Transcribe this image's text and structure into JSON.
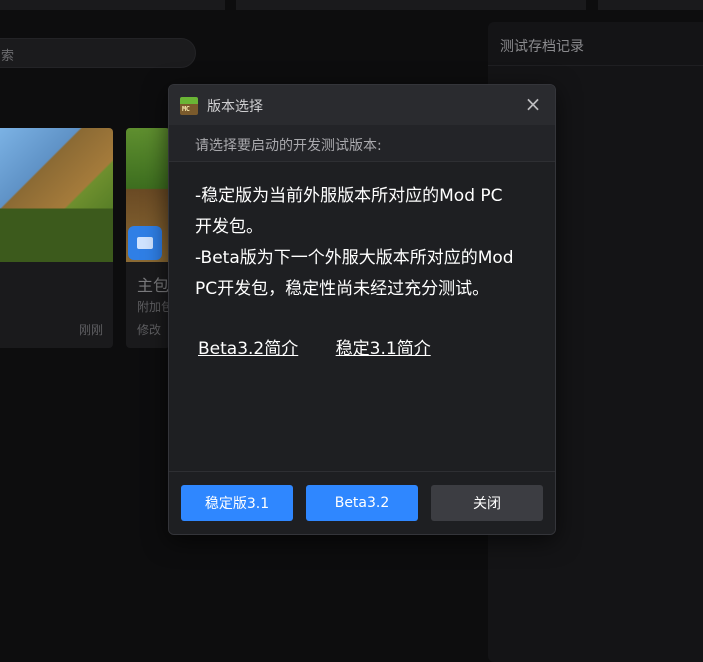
{
  "background": {
    "search_placeholder": "索",
    "cards": [
      {
        "title": "",
        "subtitle": "",
        "edit_label": "",
        "time": "刚刚"
      },
      {
        "title": "主包",
        "subtitle": "附加包",
        "edit_label": "修改",
        "time": ""
      }
    ],
    "right_panel_title": "测试存档记录"
  },
  "modal": {
    "icon": "minecraft-grass-block-icon",
    "icon_text": "MC",
    "title": "版本选择",
    "close_icon": "×",
    "subtitle": "请选择要启动的开发测试版本:",
    "description_lines": [
      "-稳定版为当前外服版本所对应的Mod PC",
      "开发包。",
      "-Beta版为下一个外服大版本所对应的Mod",
      "PC开发包，稳定性尚未经过充分测试。"
    ],
    "links": {
      "beta_intro": "Beta3.2简介",
      "stable_intro": "稳定3.1简介"
    },
    "buttons": {
      "stable": "稳定版3.1",
      "beta": "Beta3.2",
      "close": "关闭"
    }
  },
  "colors": {
    "primary_button": "#2f87ff",
    "secondary_button": "#3c3d42",
    "modal_bg": "#1e1f22"
  }
}
